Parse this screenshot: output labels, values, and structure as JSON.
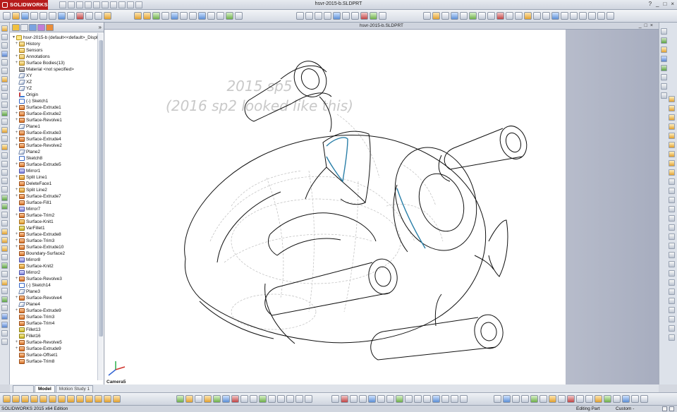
{
  "app": {
    "brand": "SOLIDWORKS",
    "window_title": "hsvr-2015-b.SLDPRT",
    "viewport_title": "hsvr-2015-b.SLDPRT",
    "window_controls": [
      "?",
      "_",
      "□",
      "×"
    ],
    "viewport_controls": [
      "_",
      "□",
      "×"
    ]
  },
  "annotation": {
    "line1": "2015 sp5",
    "line2": "(2016 sp2 looked like this)"
  },
  "feature_tree": {
    "root": "hsvr-2015-b  (default<<default>_Displa",
    "items": [
      {
        "label": "History",
        "icon": "history-folder-icon",
        "expand": "+"
      },
      {
        "label": "Sensors",
        "icon": "sensors-folder-icon",
        "expand": ""
      },
      {
        "label": "Annotations",
        "icon": "annotations-folder-icon",
        "expand": "+"
      },
      {
        "label": "Surface Bodies(13)",
        "icon": "surface-bodies-folder-icon",
        "expand": "+"
      },
      {
        "label": "Material <not specified>",
        "icon": "material-icon",
        "expand": ""
      },
      {
        "label": "XY",
        "icon": "plane-icon",
        "expand": ""
      },
      {
        "label": "XZ",
        "icon": "plane-icon",
        "expand": ""
      },
      {
        "label": "YZ",
        "icon": "plane-icon",
        "expand": ""
      },
      {
        "label": "Origin",
        "icon": "origin-icon",
        "expand": ""
      },
      {
        "label": "(-) Sketch1",
        "icon": "sketch-icon",
        "expand": ""
      },
      {
        "label": "Surface-Extrude1",
        "icon": "surface-extrude-icon",
        "expand": "+"
      },
      {
        "label": "Surface-Extrude2",
        "icon": "surface-extrude-icon",
        "expand": "+"
      },
      {
        "label": "Surface-Revolve1",
        "icon": "surface-revolve-icon",
        "expand": "+"
      },
      {
        "label": "Plane1",
        "icon": "plane-icon",
        "expand": ""
      },
      {
        "label": "Surface-Extrude3",
        "icon": "surface-extrude-icon",
        "expand": "+"
      },
      {
        "label": "Surface-Extrude4",
        "icon": "surface-extrude-icon",
        "expand": "+"
      },
      {
        "label": "Surface-Revolve2",
        "icon": "surface-revolve-icon",
        "expand": "+"
      },
      {
        "label": "Plane2",
        "icon": "plane-icon",
        "expand": ""
      },
      {
        "label": "Sketch8",
        "icon": "sketch-icon",
        "expand": ""
      },
      {
        "label": "Surface-Extrude5",
        "icon": "surface-extrude-icon",
        "expand": "+"
      },
      {
        "label": "Mirror1",
        "icon": "mirror-icon",
        "expand": ""
      },
      {
        "label": "Split Line1",
        "icon": "split-line-icon",
        "expand": "+"
      },
      {
        "label": "DeleteFace1",
        "icon": "delete-face-icon",
        "expand": ""
      },
      {
        "label": "Split Line2",
        "icon": "split-line-icon",
        "expand": "+"
      },
      {
        "label": "Surface-Extrude7",
        "icon": "surface-extrude-icon",
        "expand": "+"
      },
      {
        "label": "Surface-Fill1",
        "icon": "surface-fill-icon",
        "expand": ""
      },
      {
        "label": "Mirror7",
        "icon": "mirror-icon",
        "expand": ""
      },
      {
        "label": "Surface-Trim2",
        "icon": "surface-trim-icon",
        "expand": "+"
      },
      {
        "label": "Surface-Knit1",
        "icon": "surface-knit-icon",
        "expand": ""
      },
      {
        "label": "VarFillet1",
        "icon": "fillet-icon",
        "expand": ""
      },
      {
        "label": "Surface-Extrude8",
        "icon": "surface-extrude-icon",
        "expand": "+"
      },
      {
        "label": "Surface-Trim3",
        "icon": "surface-trim-icon",
        "expand": "+"
      },
      {
        "label": "Surface-Extrude10",
        "icon": "surface-extrude-icon",
        "expand": "+"
      },
      {
        "label": "Boundary-Surface2",
        "icon": "boundary-surface-icon",
        "expand": ""
      },
      {
        "label": "Mirror8",
        "icon": "mirror-icon",
        "expand": ""
      },
      {
        "label": "Surface-Knit2",
        "icon": "surface-knit-icon",
        "expand": ""
      },
      {
        "label": "Mirror2",
        "icon": "mirror-icon",
        "expand": ""
      },
      {
        "label": "Surface-Revolve3",
        "icon": "surface-revolve-icon",
        "expand": "+"
      },
      {
        "label": "(-) Sketch14",
        "icon": "sketch-icon",
        "expand": ""
      },
      {
        "label": "Plane3",
        "icon": "plane-icon",
        "expand": ""
      },
      {
        "label": "Surface-Revolve4",
        "icon": "surface-revolve-icon",
        "expand": "+"
      },
      {
        "label": "Plane4",
        "icon": "plane-icon",
        "expand": ""
      },
      {
        "label": "Surface-Extrude9",
        "icon": "surface-extrude-icon",
        "expand": "+"
      },
      {
        "label": "Surface-Trim3",
        "icon": "surface-trim-icon",
        "expand": ""
      },
      {
        "label": "Surface-Trim4",
        "icon": "surface-trim-icon",
        "expand": ""
      },
      {
        "label": "Fillet13",
        "icon": "fillet-icon",
        "expand": ""
      },
      {
        "label": "Fillet16",
        "icon": "fillet-icon",
        "expand": ""
      },
      {
        "label": "Surface-Revolve5",
        "icon": "surface-revolve-icon",
        "expand": "+"
      },
      {
        "label": "Surface-Extrude9",
        "icon": "surface-extrude-icon",
        "expand": "+"
      },
      {
        "label": "Surface-Offset1",
        "icon": "surface-offset-icon",
        "expand": ""
      },
      {
        "label": "Surface-Trim8",
        "icon": "surface-trim-icon",
        "expand": ""
      }
    ]
  },
  "bottom_tabs": [
    {
      "label": "Model",
      "active": true
    },
    {
      "label": "Motion Study 1",
      "active": false
    }
  ],
  "viewport": {
    "camera_label": "Camera5"
  },
  "status": {
    "edition": "SOLIDWORKS 2015 x64 Edition",
    "mode": "Editing Part",
    "units": "Custom",
    "units_indicator": "-"
  },
  "colors": {
    "brand_red": "#b61c1c",
    "annotation_gray": "#c9c9c9",
    "edge_highlight": "#2a7fa8"
  }
}
